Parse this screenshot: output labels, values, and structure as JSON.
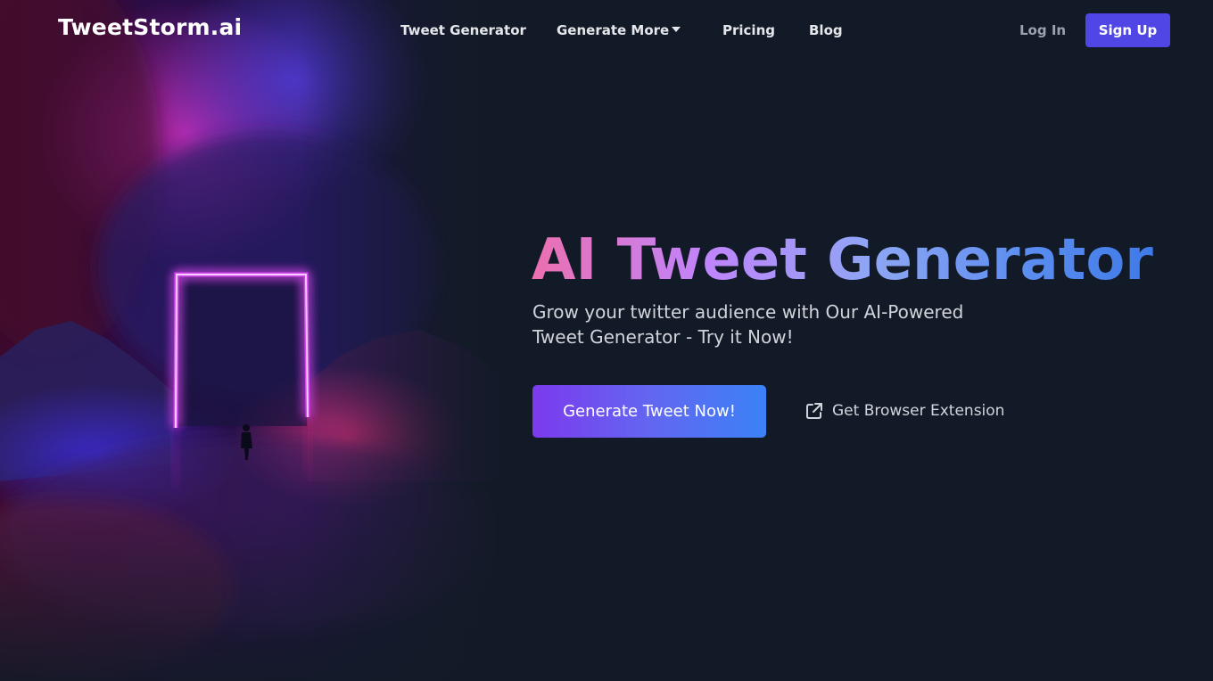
{
  "nav": {
    "brand": "TweetStorm.ai",
    "links": [
      {
        "label": "Tweet Generator"
      },
      {
        "label": "Generate More"
      },
      {
        "label": "Pricing"
      },
      {
        "label": "Blog"
      }
    ],
    "login": "Log In",
    "signup": "Sign Up"
  },
  "hero": {
    "title": "AI Tweet Generator",
    "subtitle": "Grow your twitter audience with Our AI-Powered Tweet Generator - Try it Now!",
    "cta": "Generate Tweet Now!",
    "extension_link": "Get Browser Extension"
  },
  "colors": {
    "background": "#131a27",
    "accent": "#4f46e5",
    "title_gradient": [
      "#ec6fb0",
      "#c084fc",
      "#5b8def"
    ],
    "cta_gradient": [
      "#7c3aed",
      "#3b82f6"
    ]
  },
  "icons": {
    "dropdown": "chevron-down-icon",
    "extension": "external-link-icon"
  }
}
